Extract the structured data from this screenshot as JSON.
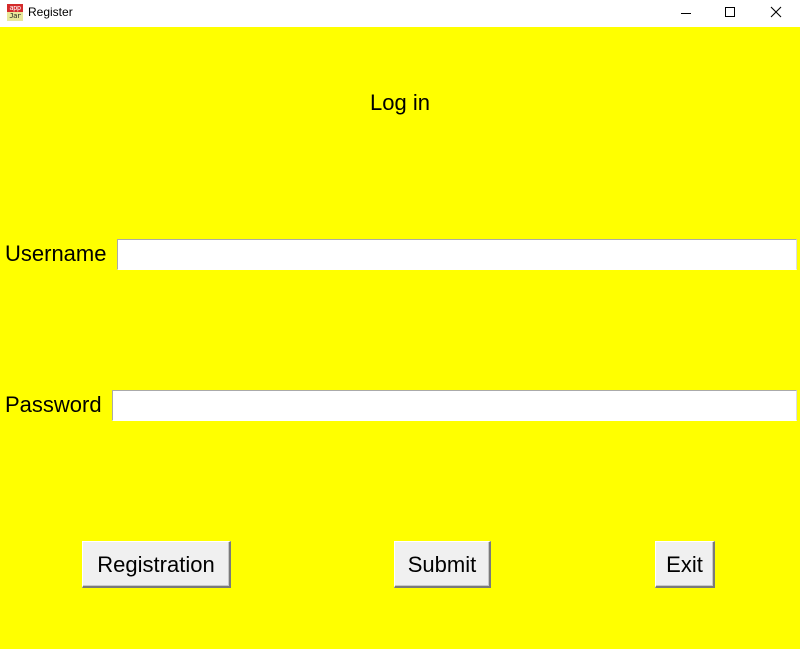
{
  "window": {
    "title": "Register",
    "icon": "app-jar-icon",
    "icon_text_top": "app",
    "icon_text_bottom": "Jar",
    "background_color": "#ffff00"
  },
  "titlebar_controls": {
    "minimize_icon": "minimize-icon",
    "maximize_icon": "maximize-icon",
    "close_icon": "close-icon"
  },
  "form": {
    "heading": "Log in",
    "username_label": "Username",
    "username_value": "",
    "password_label": "Password",
    "password_value": ""
  },
  "buttons": {
    "registration": "Registration",
    "submit": "Submit",
    "exit": "Exit"
  }
}
